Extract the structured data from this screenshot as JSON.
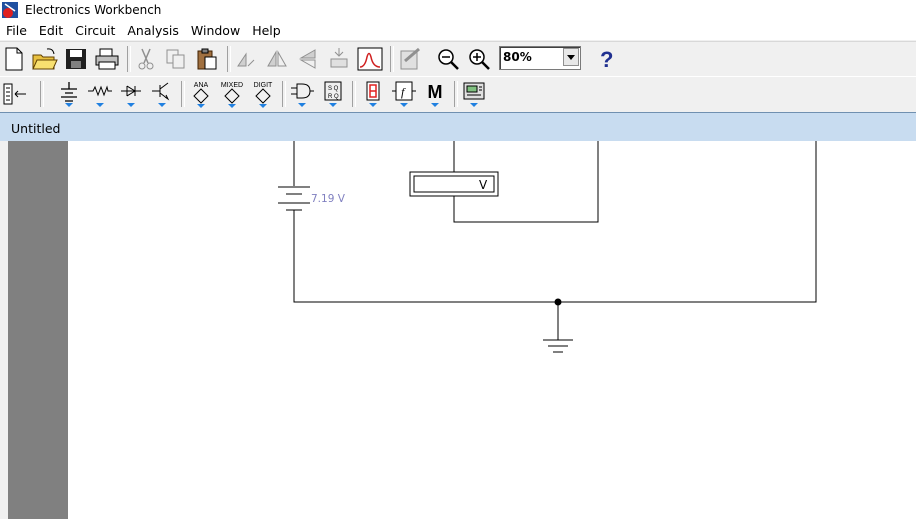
{
  "app": {
    "title": "Electronics Workbench"
  },
  "menu": [
    "File",
    "Edit",
    "Circuit",
    "Analysis",
    "Window",
    "Help"
  ],
  "toolbar": {
    "zoom_value": "80%",
    "parts_labels": {
      "analog": "ANA",
      "mixed": "MIXED",
      "digital": "DIGIT",
      "meter": "M"
    }
  },
  "document": {
    "title": "Untitled"
  },
  "circuit": {
    "battery_label": "7.19 V",
    "voltmeter_label": "V"
  },
  "colors": {
    "battery_label": "#8080c0",
    "doc_bar": "#c8dcf0"
  }
}
